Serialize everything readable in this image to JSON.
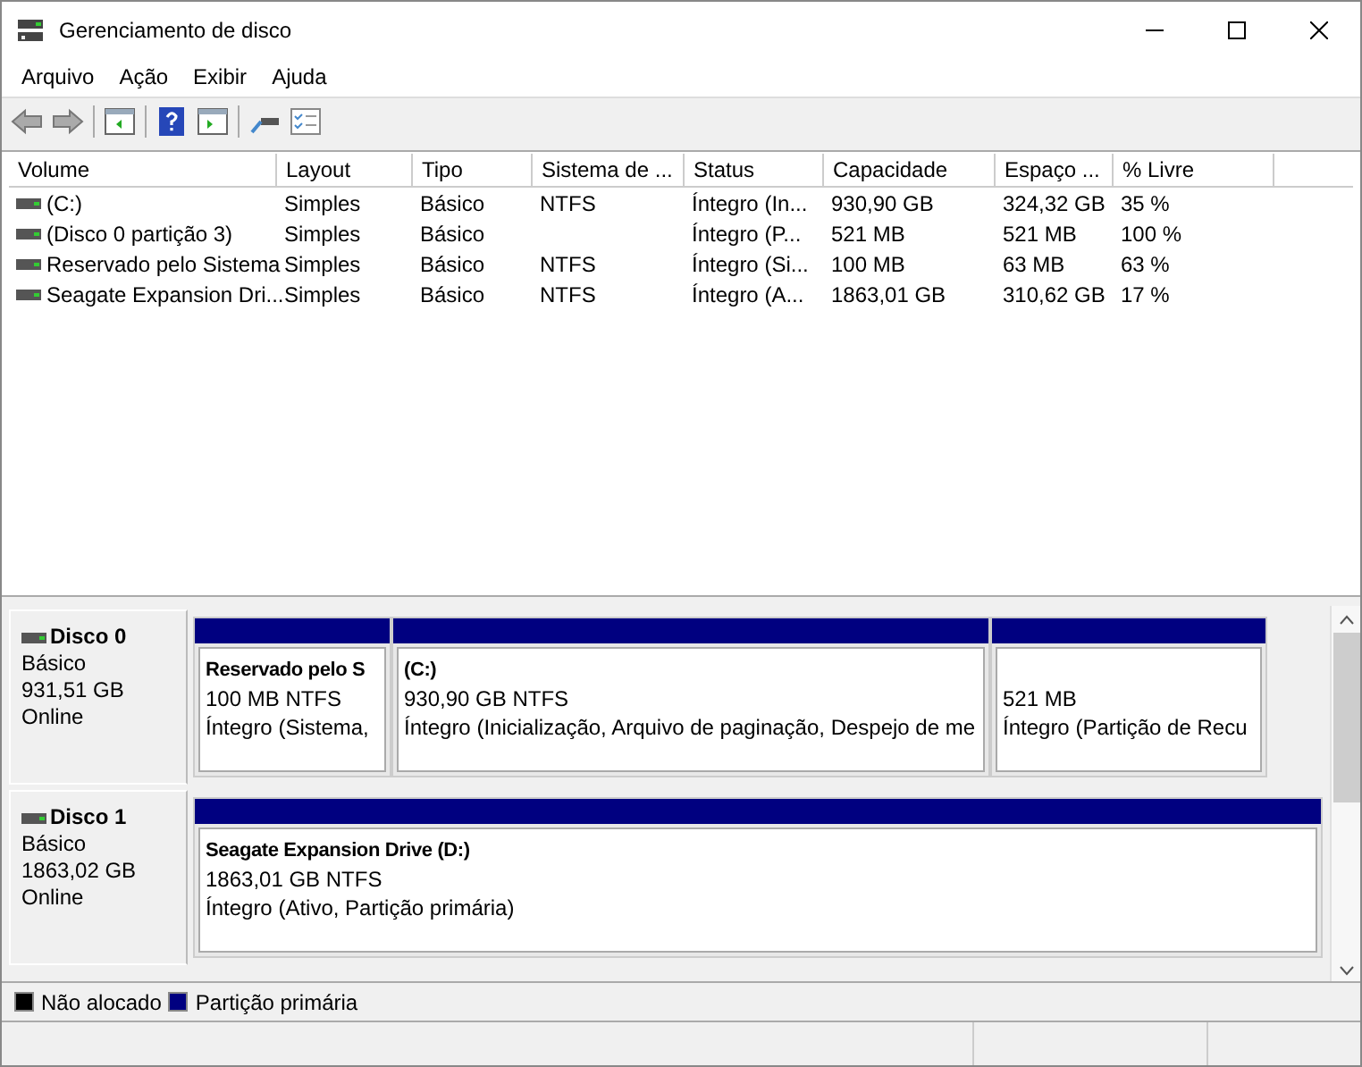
{
  "window": {
    "title": "Gerenciamento de disco"
  },
  "menu": [
    "Arquivo",
    "Ação",
    "Exibir",
    "Ajuda"
  ],
  "table": {
    "columns": [
      "Volume",
      "Layout",
      "Tipo",
      "Sistema de ...",
      "Status",
      "Capacidade",
      "Espaço ...",
      "% Livre"
    ],
    "rows": [
      [
        "(C:)",
        "Simples",
        "Básico",
        "NTFS",
        "Íntegro (In...",
        "930,90 GB",
        "324,32 GB",
        "35 %"
      ],
      [
        "(Disco 0 partição 3)",
        "Simples",
        "Básico",
        "",
        "Íntegro (P...",
        "521 MB",
        "521 MB",
        "100 %"
      ],
      [
        "Reservado pelo Sistema",
        "Simples",
        "Básico",
        "NTFS",
        "Íntegro (Si...",
        "100 MB",
        "63 MB",
        "63 %"
      ],
      [
        "Seagate Expansion Dri...",
        "Simples",
        "Básico",
        "NTFS",
        "Íntegro (A...",
        "1863,01 GB",
        "310,62 GB",
        "17 %"
      ]
    ]
  },
  "disks": [
    {
      "name": "Disco 0",
      "type": "Básico",
      "size": "931,51 GB",
      "state": "Online",
      "partitions": [
        {
          "name": "Reservado pelo S",
          "size": "100 MB NTFS",
          "status": "Íntegro (Sistema,",
          "color": "#000080"
        },
        {
          "name": "(C:)",
          "size": "930,90 GB NTFS",
          "status": "Íntegro (Inicialização, Arquivo de paginação, Despejo de me",
          "color": "#000080"
        },
        {
          "size": "521 MB",
          "status": "Íntegro (Partição de Recu",
          "color": "#000080"
        }
      ]
    },
    {
      "name": "Disco 1",
      "type": "Básico",
      "size": "1863,02 GB",
      "state": "Online",
      "partitions": [
        {
          "name": "Seagate Expansion Drive  (D:)",
          "size": "1863,01 GB NTFS",
          "status": "Íntegro (Ativo, Partição primária)",
          "color": "#000080"
        }
      ]
    }
  ],
  "legend": [
    {
      "label": "Não alocado",
      "color": "#000000"
    },
    {
      "label": "Partição primária",
      "color": "#000080"
    }
  ]
}
